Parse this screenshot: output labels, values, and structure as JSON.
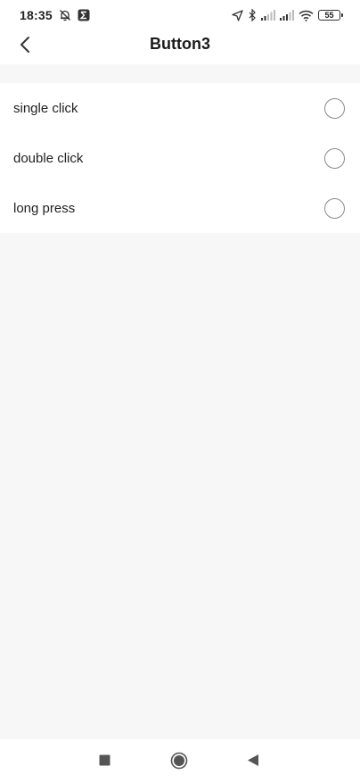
{
  "status_bar": {
    "time": "18:35",
    "battery_level": "55",
    "icons": [
      "alarm-off-icon",
      "app-notification-icon",
      "location-icon",
      "bluetooth-icon",
      "signal-icon",
      "signal-icon",
      "wifi-icon",
      "battery-icon"
    ]
  },
  "header": {
    "title": "Button3",
    "back_icon": "chevron-left-icon"
  },
  "options": [
    {
      "label": "single click",
      "selected": false
    },
    {
      "label": "double click",
      "selected": false
    },
    {
      "label": "long press",
      "selected": false
    }
  ],
  "nav": {
    "recents_icon": "square-icon",
    "home_icon": "circle-icon",
    "back_icon": "triangle-back-icon"
  },
  "colors": {
    "background": "#f7f7f7",
    "surface": "#ffffff",
    "text": "#1a1a1a",
    "radio_border": "#8a8a8a"
  }
}
